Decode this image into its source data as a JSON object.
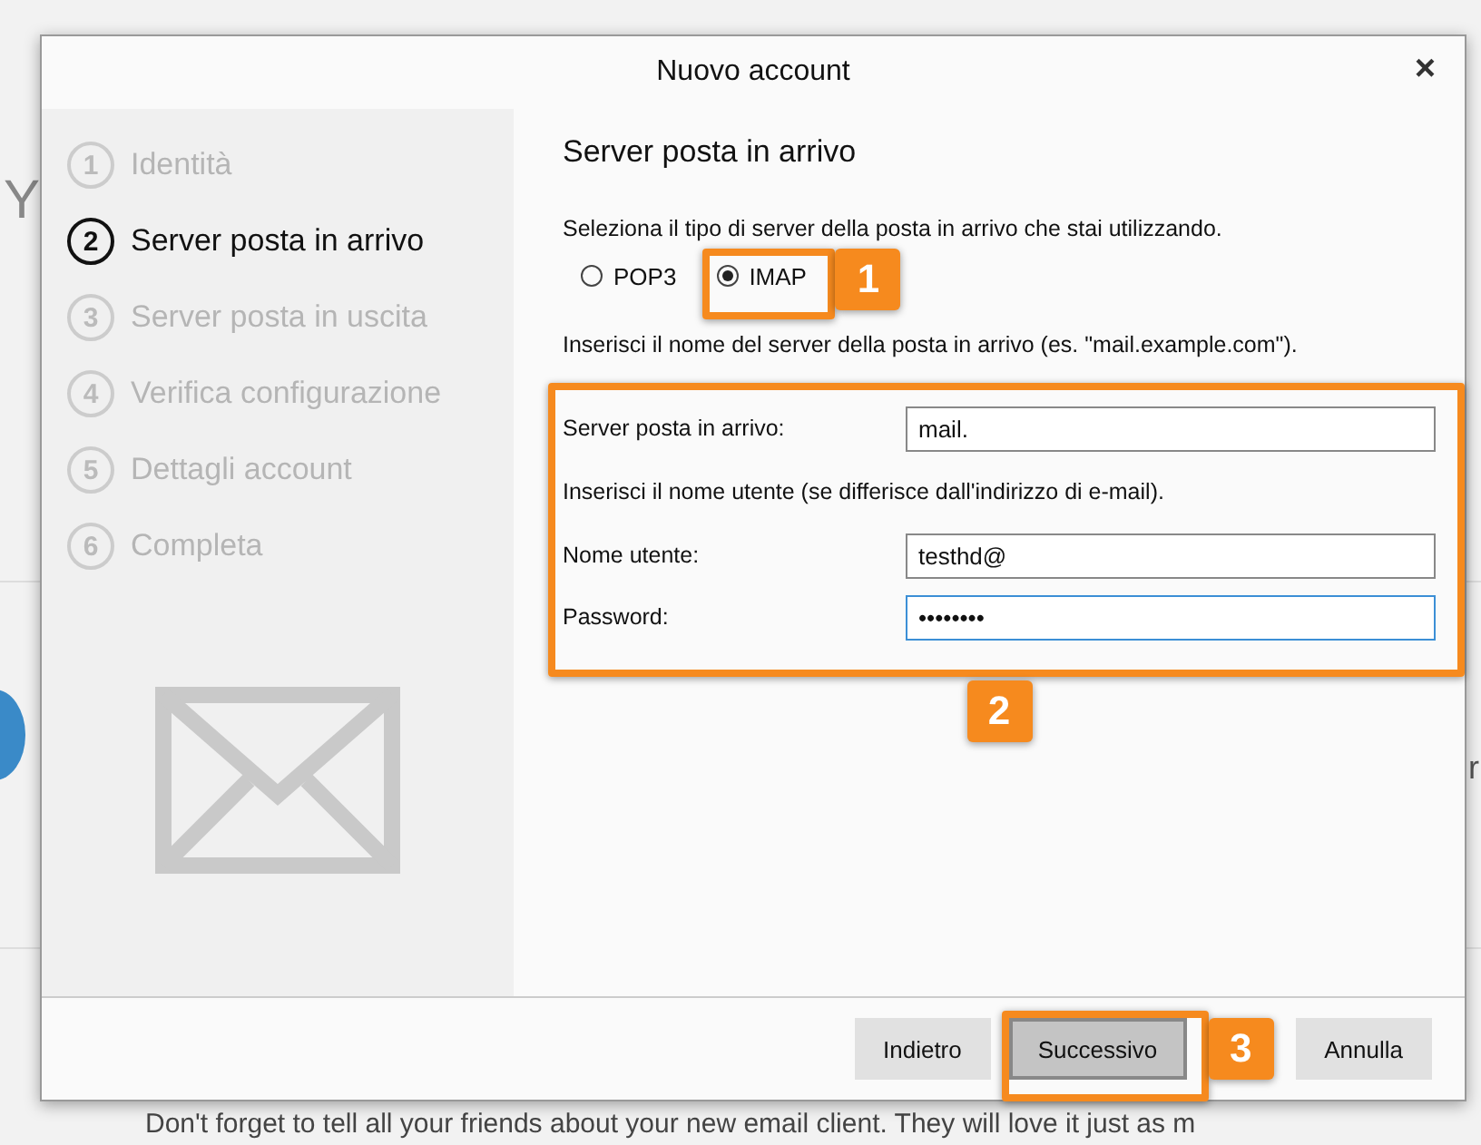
{
  "background": {
    "letter_left": "Y",
    "letter_right": "r",
    "footer_text": "Don't forget to tell all your friends about your new email client. They will love it just as m"
  },
  "window": {
    "title": "Nuovo account",
    "close": "×"
  },
  "steps": [
    {
      "number": "1",
      "label": "Identità",
      "selected": false
    },
    {
      "number": "2",
      "label": "Server posta in arrivo",
      "selected": true
    },
    {
      "number": "3",
      "label": "Server posta in uscita",
      "selected": false
    },
    {
      "number": "4",
      "label": "Verifica configurazione",
      "selected": false
    },
    {
      "number": "5",
      "label": "Dettagli account",
      "selected": false
    },
    {
      "number": "6",
      "label": "Completa",
      "selected": false
    }
  ],
  "heading": "Server posta in arrivo",
  "server_type_prompt": "Seleziona il tipo di server della posta in arrivo che stai utilizzando.",
  "server_types": [
    {
      "label": "POP3",
      "selected": false
    },
    {
      "label": "IMAP",
      "selected": true
    }
  ],
  "server_hint": "Inserisci il nome del server della posta in arrivo (es. \"mail.example.com\").",
  "fields": [
    {
      "kind": "field",
      "label": "Server posta in arrivo:",
      "value": "mail.",
      "focused": false
    },
    {
      "kind": "note",
      "text": "Inserisci il nome utente (se differisce dall'indirizzo di e-mail)."
    },
    {
      "kind": "field",
      "label": "Nome utente:",
      "value": "testhd@",
      "focused": false
    },
    {
      "kind": "field",
      "label": "Password:",
      "value": "••••••••",
      "focused": true
    }
  ],
  "buttons": [
    {
      "label": "Indietro",
      "selected": false
    },
    {
      "label": "Successivo",
      "selected": true
    },
    {
      "label": "Annulla",
      "selected": false
    }
  ],
  "annotations": [
    {
      "label": "1"
    },
    {
      "label": "2"
    },
    {
      "label": "3"
    }
  ]
}
